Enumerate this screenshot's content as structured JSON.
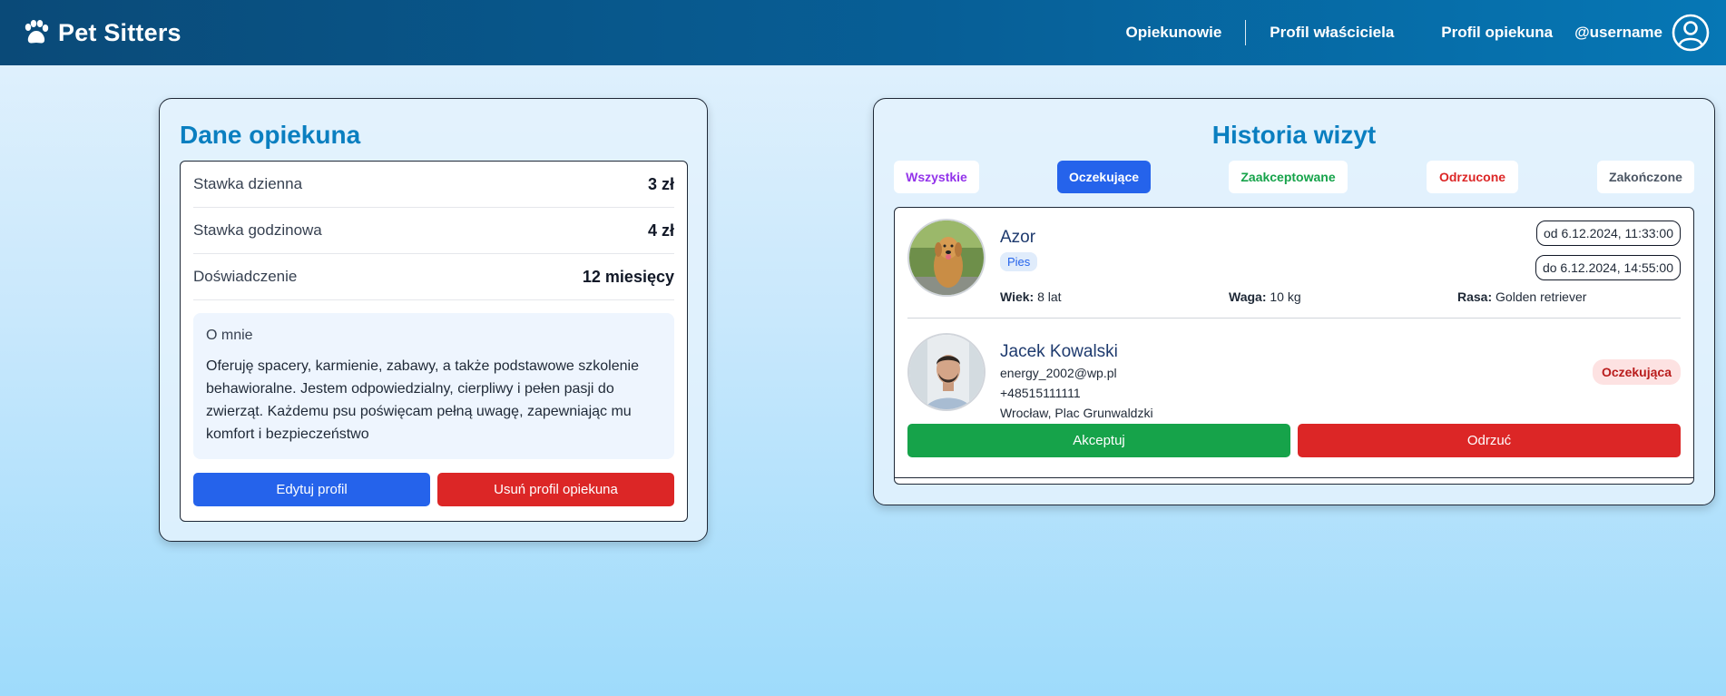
{
  "header": {
    "brand": "Pet Sitters",
    "nav": [
      "Opiekunowie",
      "Profil właściciela",
      "Profil opiekuna"
    ],
    "username": "@username"
  },
  "sitter": {
    "title": "Dane opiekuna",
    "rows": [
      {
        "label": "Stawka dzienna",
        "value": "3 zł"
      },
      {
        "label": "Stawka godzinowa",
        "value": "4 zł"
      },
      {
        "label": "Doświadczenie",
        "value": "12 miesięcy"
      }
    ],
    "about_title": "O mnie",
    "about_text": "Oferuję spacery, karmienie, zabawy, a także podstawowe szkolenie behawioralne. Jestem odpowiedzialny, cierpliwy i pełen pasji do zwierząt. Każdemu psu poświęcam pełną uwagę, zapewniając mu komfort i bezpieczeństwo",
    "edit_label": "Edytuj profil",
    "delete_label": "Usuń profil opiekuna"
  },
  "history": {
    "title": "Historia wizyt",
    "filters": [
      {
        "label": "Wszystkie",
        "color": "#9333ea"
      },
      {
        "label": "Oczekujące",
        "color": "#ffffff"
      },
      {
        "label": "Zaakceptowane",
        "color": "#16a34a"
      },
      {
        "label": "Odrzucone",
        "color": "#dc2626"
      },
      {
        "label": "Zakończone",
        "color": "#4b5563"
      }
    ],
    "visit": {
      "pet_name": "Azor",
      "pet_type": "Pies",
      "date_from": "od 6.12.2024, 11:33:00",
      "date_to": "do 6.12.2024, 14:55:00",
      "age_label": "Wiek:",
      "age_value": "8 lat",
      "weight_label": "Waga:",
      "weight_value": "10 kg",
      "breed_label": "Rasa:",
      "breed_value": "Golden retriever",
      "owner_name": "Jacek Kowalski",
      "owner_email": "energy_2002@wp.pl",
      "owner_phone": "+48515111111",
      "owner_address": "Wrocław, Plac Grunwaldzki",
      "status": "Oczekująca",
      "accept_label": "Akceptuj",
      "reject_label": "Odrzuć"
    }
  }
}
